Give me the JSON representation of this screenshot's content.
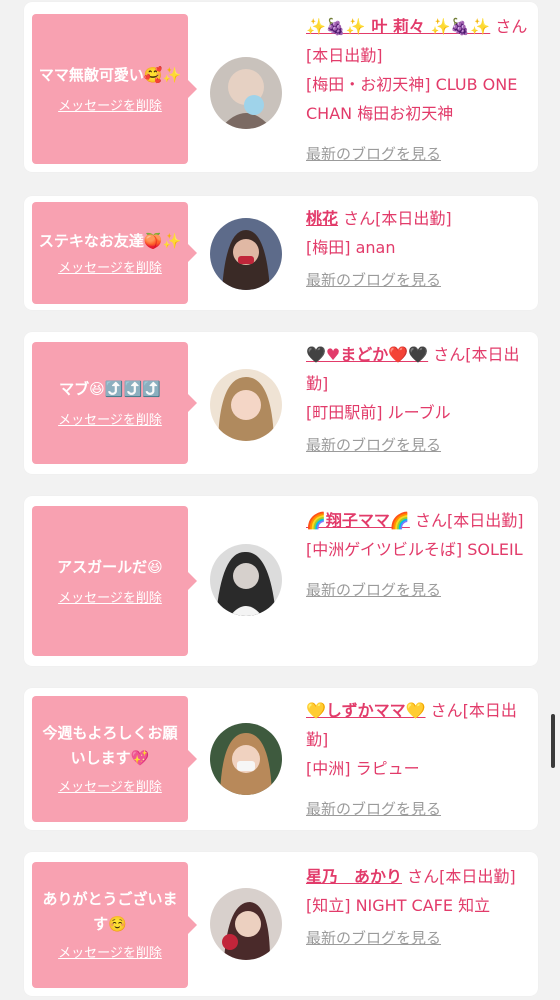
{
  "colors": {
    "bubble": "#f8a1b1",
    "accent": "#e23b6a",
    "link_gray": "#9b9b9b",
    "background": "#f2f2f2"
  },
  "cards": [
    {
      "message": "ママ無敵可愛い🥰✨",
      "delete_label": "メッセージを削除",
      "name": "✨🍇✨ 叶 莉々 ✨🍇✨",
      "suffix": " さん[本日出勤]",
      "location": "[梅田・お初天神] CLUB ONE CHAN 梅田お初天神",
      "blog_label": "最新のブログを見る",
      "avatar_icon": "avatar-photo"
    },
    {
      "message": "ステキなお友達🍑✨",
      "delete_label": "メッセージを削除",
      "name": "桃花",
      "suffix": " さん[本日出勤]",
      "location": "[梅田] anan",
      "blog_label": "最新のブログを見る",
      "avatar_icon": "avatar-photo"
    },
    {
      "message": "マブ😆⤴️⤴️⤴️",
      "delete_label": "メッセージを削除",
      "name": "🖤♥まどか❤️🖤",
      "suffix": " さん[本日出勤]",
      "location": "[町田駅前] ルーブル",
      "blog_label": "最新のブログを見る",
      "avatar_icon": "avatar-photo"
    },
    {
      "message": "アスガールだ😆",
      "delete_label": "メッセージを削除",
      "name": "🌈翔子ママ🌈",
      "suffix": " さん[本日出勤]",
      "location": "[中洲ゲイツビルそば] SOLEIL",
      "blog_label": "最新のブログを見る",
      "avatar_icon": "avatar-photo"
    },
    {
      "message": "今週もよろしくお願いします💖",
      "delete_label": "メッセージを削除",
      "name": "💛しずかママ💛",
      "suffix": " さん[本日出勤]",
      "location": "[中洲] ラピュー",
      "blog_label": "最新のブログを見る",
      "avatar_icon": "avatar-photo"
    },
    {
      "message": "ありがとうございます☺️",
      "delete_label": "メッセージを削除",
      "name": "星乃　あかり",
      "suffix": " さん[本日出勤]",
      "location": "[知立] NIGHT CAFE 知立",
      "blog_label": "最新のブログを見る",
      "avatar_icon": "avatar-photo"
    }
  ]
}
